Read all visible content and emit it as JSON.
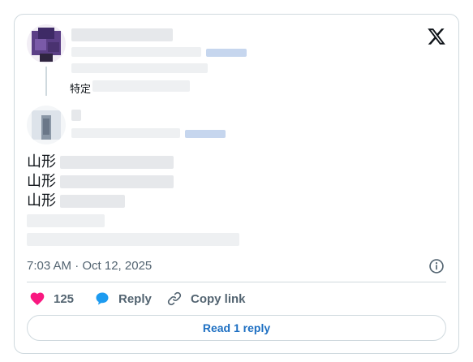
{
  "reply_context": {
    "prefix": "特定"
  },
  "tweet": {
    "lines": [
      "山形",
      "山形",
      "山形"
    ],
    "timestamp": "7:03 AM · Oct 12, 2025"
  },
  "actions": {
    "likes_count": "125",
    "reply_label": "Reply",
    "copy_link_label": "Copy link"
  },
  "read_replies_label": "Read 1 reply",
  "colors": {
    "like": "#f91880",
    "reply": "#1d9bf0",
    "link": "#1d6fc2",
    "muted": "#536471"
  },
  "icons": [
    "x-logo-icon",
    "info-icon",
    "heart-icon",
    "reply-bubble-icon",
    "link-icon"
  ]
}
